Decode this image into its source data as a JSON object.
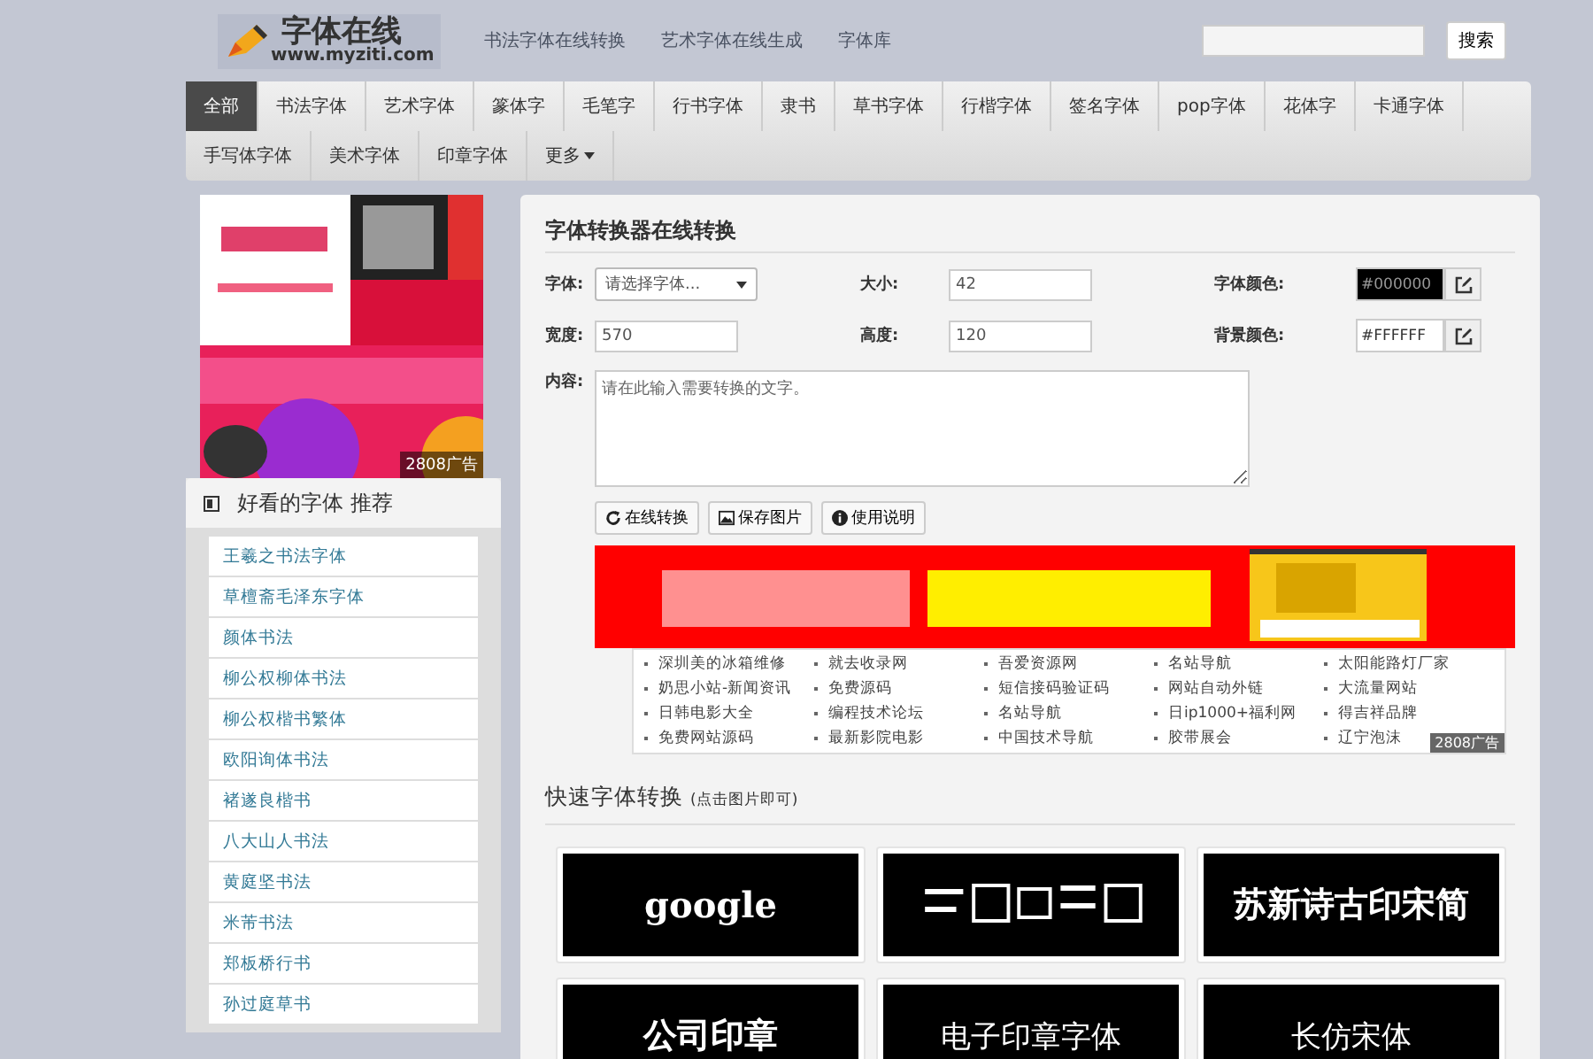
{
  "header": {
    "logo_text": "字体在线",
    "logo_url": "www.myziti.com",
    "links": [
      "书法字体在线转换",
      "艺术字体在线生成",
      "字体库"
    ],
    "search_button": "搜索"
  },
  "nav": [
    {
      "label": "全部",
      "selected": true
    },
    {
      "label": "书法字体",
      "selected": false
    },
    {
      "label": "艺术字体",
      "selected": false
    },
    {
      "label": "篆体字",
      "selected": false
    },
    {
      "label": "毛笔字",
      "selected": false
    },
    {
      "label": "行书字体",
      "selected": false
    },
    {
      "label": "隶书",
      "selected": false
    },
    {
      "label": "草书字体",
      "selected": false
    },
    {
      "label": "行楷字体",
      "selected": false
    },
    {
      "label": "签名字体",
      "selected": false
    },
    {
      "label": "pop字体",
      "selected": false
    },
    {
      "label": "花体字",
      "selected": false
    },
    {
      "label": "卡通字体",
      "selected": false
    },
    {
      "label": "手写体字体",
      "selected": false
    },
    {
      "label": "美术字体",
      "selected": false
    },
    {
      "label": "印章字体",
      "selected": false
    },
    {
      "label": "更多",
      "selected": false,
      "dropdown": true
    }
  ],
  "sidebar": {
    "ad_label": "2808广告",
    "title": "好看的字体 推荐",
    "items": [
      "王羲之书法字体",
      "草檀斋毛泽东字体",
      "颜体书法",
      "柳公权柳体书法",
      "柳公权楷书繁体",
      "欧阳询体书法",
      "褚遂良楷书",
      "八大山人书法",
      "黄庭坚书法",
      "米芾书法",
      "郑板桥行书",
      "孙过庭草书"
    ]
  },
  "converter": {
    "title": "字体转换器在线转换",
    "fields": [
      {
        "label": "字体:",
        "kind": "select",
        "value": "请选择字体..."
      },
      {
        "label": "大小:",
        "kind": "input",
        "value": "42"
      },
      {
        "label": "字体颜色:",
        "kind": "color",
        "value": "#000000"
      },
      {
        "label": "宽度:",
        "kind": "input",
        "value": "570"
      },
      {
        "label": "高度:",
        "kind": "input",
        "value": "120"
      },
      {
        "label": "背景颜色:",
        "kind": "color",
        "value": "#FFFFFF"
      }
    ],
    "content_label": "内容:",
    "content_placeholder": "请在此输入需要转换的文字。",
    "buttons": [
      {
        "label": "在线转换"
      },
      {
        "label": "保存图片"
      },
      {
        "label": "使用说明"
      }
    ]
  },
  "ad_links": {
    "items": [
      "深圳美的冰箱维修",
      "就去收录网",
      "吾爱资源网",
      "名站导航",
      "太阳能路灯厂家",
      "奶思小站-新闻资讯",
      "免费源码",
      "短信接码验证码",
      "网站自动外链",
      "大流量网站",
      "日韩电影大全",
      "编程技术论坛",
      "名站导航",
      "日ip1000+福利网",
      "得吉祥品牌",
      "免费网站源码",
      "最新影院电影",
      "中国技术导航",
      "胶带展会",
      "辽宁泡沫"
    ],
    "ad_label": "2808广告"
  },
  "quick": {
    "title": "快速字体转换",
    "hint": "(点击图片即可)",
    "tiles": [
      {
        "kind": "text",
        "text": "google"
      },
      {
        "kind": "picture"
      },
      {
        "kind": "text",
        "text": "苏新诗古印宋简"
      },
      {
        "kind": "text",
        "text": "公司印章"
      },
      {
        "kind": "text",
        "text": "电子印章字体"
      },
      {
        "kind": "text",
        "text": "长仿宋体"
      }
    ]
  }
}
